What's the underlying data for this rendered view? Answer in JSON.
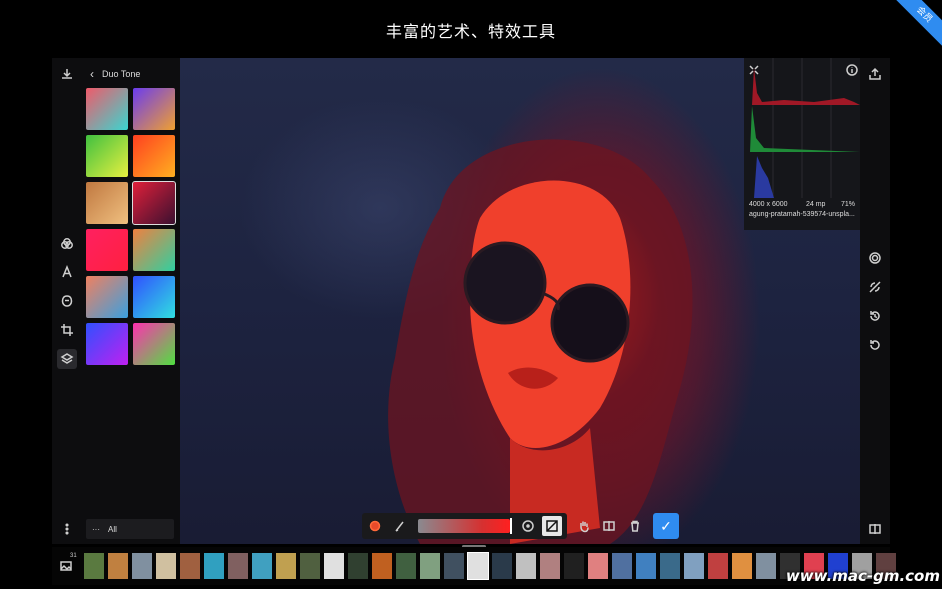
{
  "headline": "丰富的艺术、特效工具",
  "ribbon": "会员",
  "panel": {
    "title": "Duo Tone",
    "filter_label": "All"
  },
  "swatches": [
    "linear-gradient(135deg,#f05a6a,#3ad6d0)",
    "linear-gradient(135deg,#6a3cf0,#f0a030)",
    "linear-gradient(135deg,#40c040,#e8f040)",
    "linear-gradient(135deg,#ff4020,#ffb020)",
    "linear-gradient(135deg,#c07840,#f0c080)",
    "linear-gradient(135deg,#e0203a,#3a1030)",
    "linear-gradient(135deg,#ff2060,#ff2040)",
    "linear-gradient(135deg,#f08040,#30d0a0)",
    "linear-gradient(135deg,#f08060,#3aa0e0)",
    "linear-gradient(135deg,#3050ff,#30e0e0)",
    "linear-gradient(135deg,#3050ff,#c020f0)",
    "linear-gradient(135deg,#ff30b0,#50e040)"
  ],
  "selected_swatch": 5,
  "histogram": {
    "dimensions": "4000 x 6000",
    "megapixels": "24 mp",
    "zoom": "71%",
    "filename": "agung-pratamah-539574-unspla..."
  },
  "filmstrip_badge": "31",
  "watermark": "www.mac-gm.com",
  "colors": {
    "accent": "#2f8cf0",
    "panel_bg": "#0d0d0f"
  }
}
